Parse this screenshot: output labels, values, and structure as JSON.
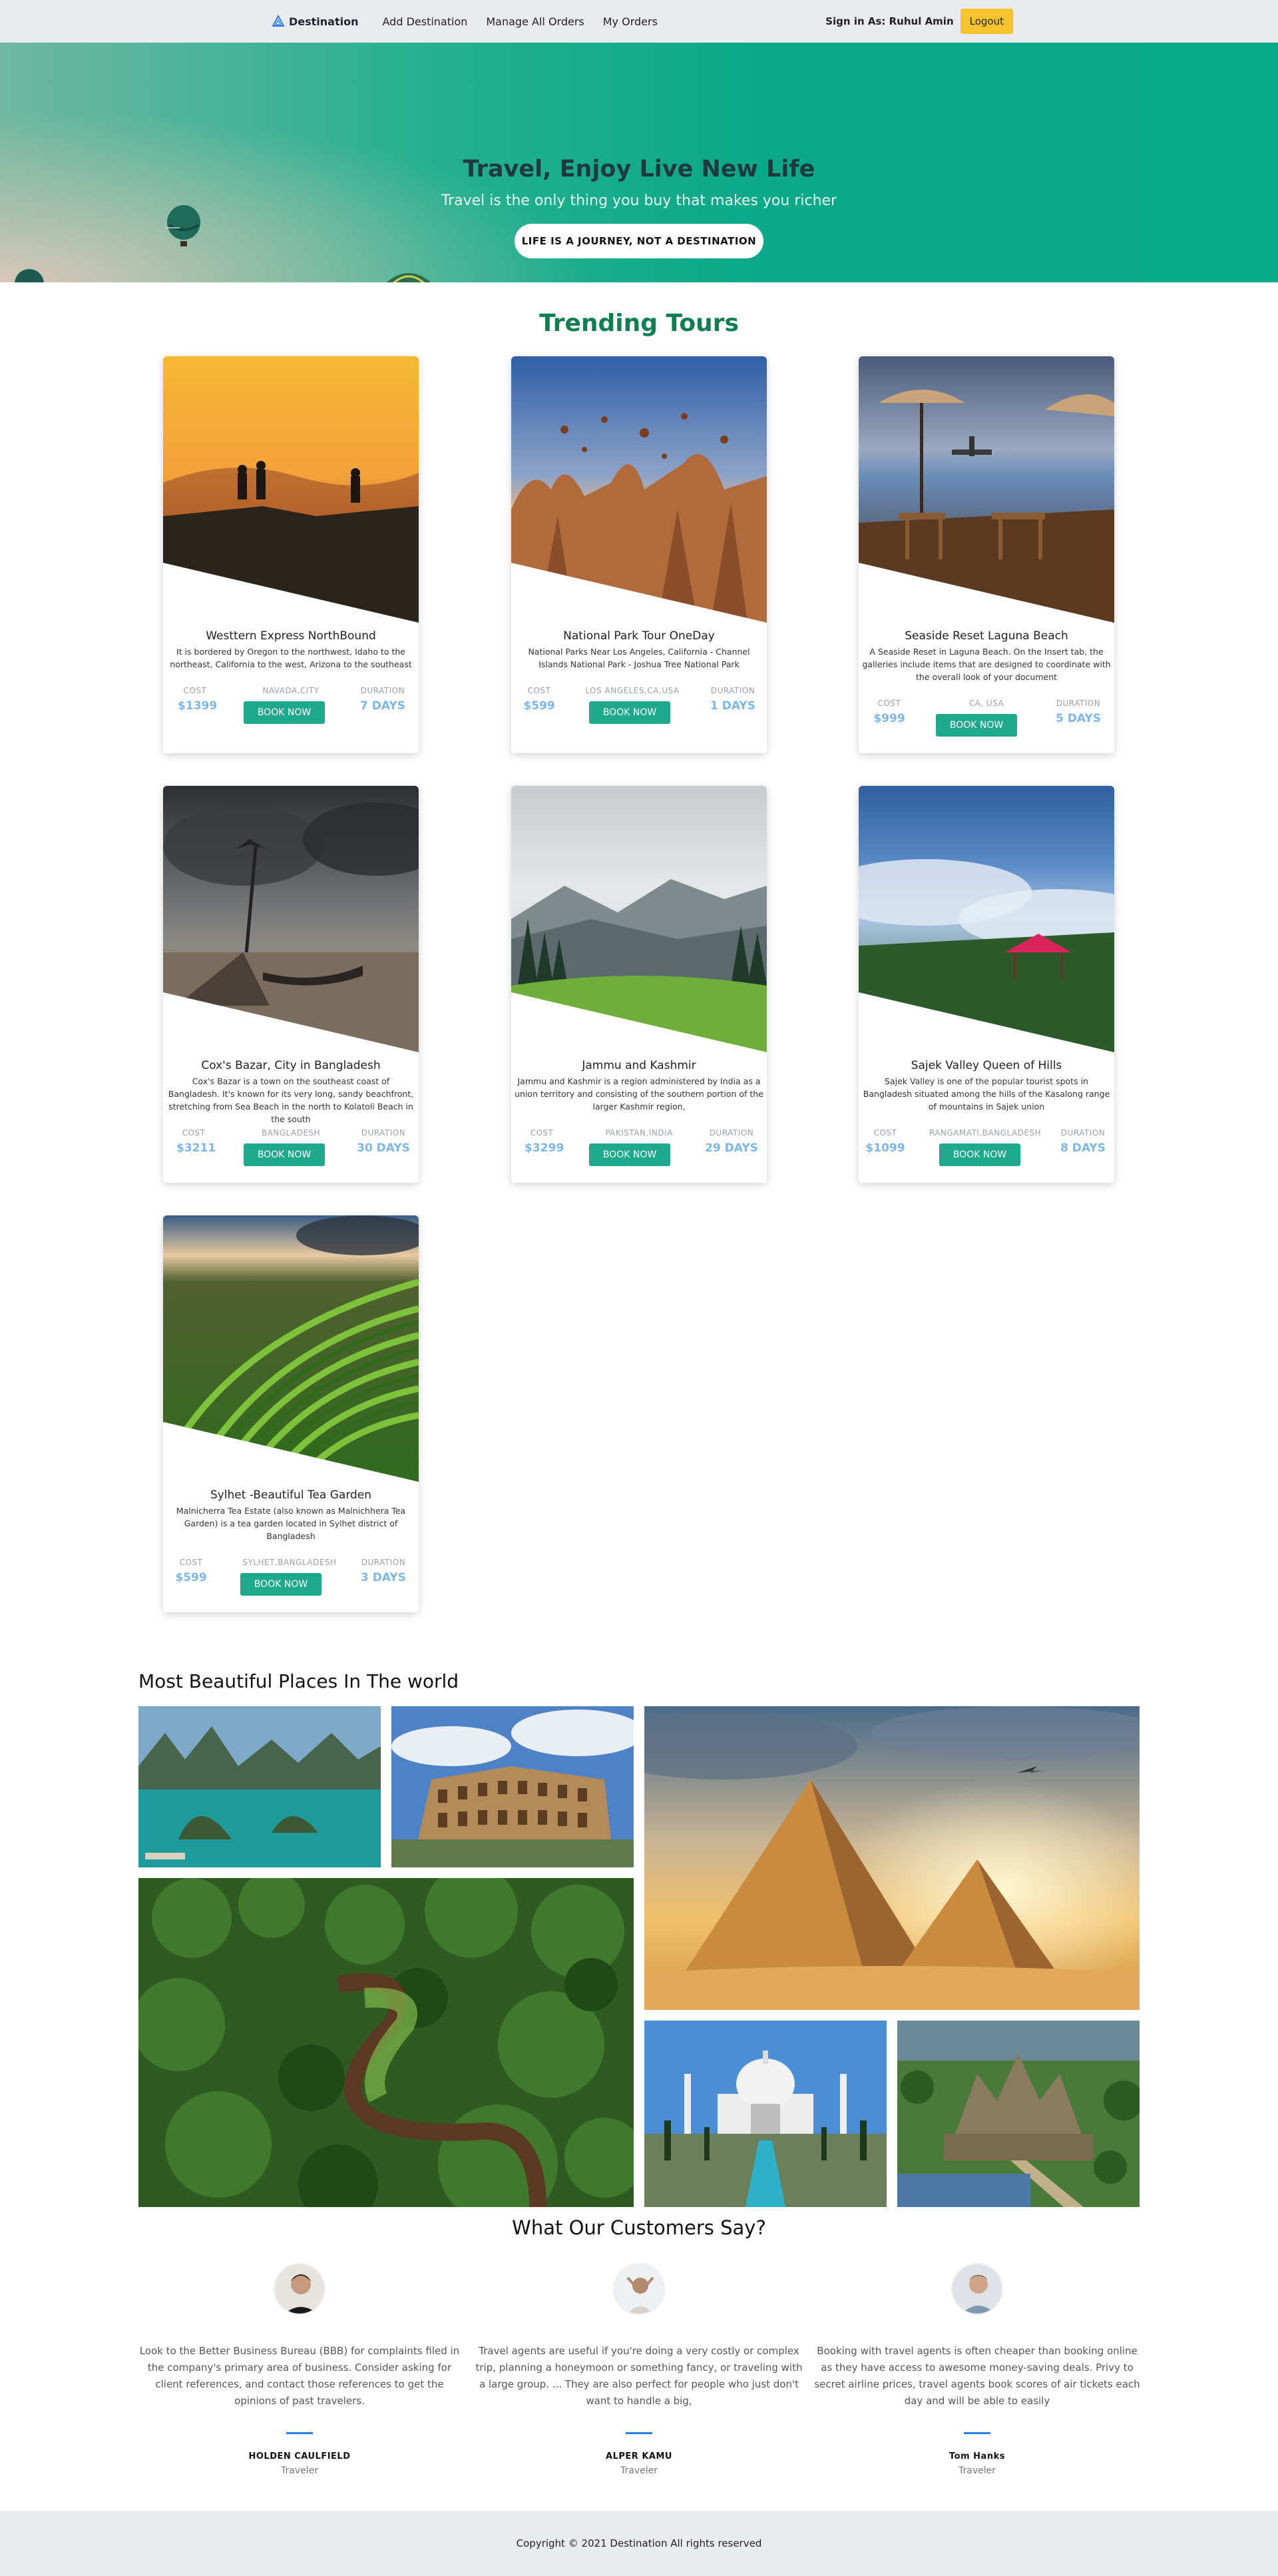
{
  "nav": {
    "brand": "Destination",
    "links": [
      "Add Destination",
      "Manage All Orders",
      "My Orders"
    ],
    "signin": "Sign in As: Ruhul Amin",
    "logout": "Logout"
  },
  "hero": {
    "title": "Travel, Enjoy Live New Life",
    "subtitle": "Travel is the only thing you buy that makes you richer",
    "button": "LIFE IS A JOURNEY, NOT A DESTINATION"
  },
  "trending": {
    "title": "Trending Tours",
    "labels": {
      "cost": "COST",
      "duration": "DURATION",
      "book": "BOOK NOW"
    },
    "tours": [
      {
        "title": "Westtern Express NorthBound",
        "desc": "It is bordered by Oregon to the northwest, Idaho to the northeast, California to the west, Arizona to the southeast",
        "cost": "$1399",
        "location": "NAVADA,CITY",
        "duration": "7 DAYS"
      },
      {
        "title": "National Park Tour OneDay",
        "desc": "National Parks Near Los Angeles, California - Channel Islands National Park - Joshua Tree National Park",
        "cost": "$599",
        "location": "LOS ANGELES,CA,USA",
        "duration": "1 DAYS"
      },
      {
        "title": "Seaside Reset Laguna Beach",
        "desc": "A Seaside Reset in Laguna Beach. On the Insert tab, the galleries include items that are designed to coordinate with the overall look of your document",
        "cost": "$999",
        "location": "CA, USA",
        "duration": "5 DAYS"
      },
      {
        "title": "Cox's Bazar, City in Bangladesh",
        "desc": "Cox's Bazar is a town on the southeast coast of Bangladesh. It's known for its very long, sandy beachfront, stretching from Sea Beach in the north to Kolatoli Beach in the south",
        "cost": "$3211",
        "location": "BANGLADESH",
        "duration": "30 DAYS"
      },
      {
        "title": "Jammu and Kashmir",
        "desc": "Jammu and Kashmir is a region administered by India as a union territory and consisting of the southern portion of the larger Kashmir region,",
        "cost": "$3299",
        "location": "PAKISTAN,INDIA",
        "duration": "29 DAYS"
      },
      {
        "title": "Sajek Valley Queen of Hills",
        "desc": "Sajek Valley is one of the popular tourist spots in Bangladesh situated among the hills of the Kasalong range of mountains in Sajek union",
        "cost": "$1099",
        "location": "RANGAMATI,BANGLADESH",
        "duration": "8 DAYS"
      },
      {
        "title": "Sylhet -Beautiful Tea Garden",
        "desc": "Malnicherra Tea Estate (also known as Malnichhera Tea Garden) is a tea garden located in Sylhet district of Bangladesh",
        "cost": "$599",
        "location": "SYLHET,BANGLADESH",
        "duration": "3 DAYS"
      }
    ]
  },
  "gallery": {
    "title": "Most Beautiful Places In The world"
  },
  "testimonials": {
    "title": "What Our Customers Say?",
    "items": [
      {
        "text": "Look to the Better Business Bureau (BBB) for complaints filed in the company's primary area of business. Consider asking for client references, and contact those references to get the opinions of past travelers.",
        "name": "HOLDEN CAULFIELD",
        "role": "Traveler"
      },
      {
        "text": "Travel agents are useful if you're doing a very costly or complex trip, planning a honeymoon or something fancy, or traveling with a large group. ... They are also perfect for people who just don't want to handle a big,",
        "name": "ALPER KAMU",
        "role": "Traveler"
      },
      {
        "text": "Booking with travel agents is often cheaper than booking online as they have access to awesome money-saving deals. Privy to secret airline prices, travel agents book scores of air tickets each day and will be able to easily",
        "name": "Tom Hanks",
        "role": "Traveler"
      }
    ]
  },
  "footer": {
    "text": "Copyright © 2021 Destination All rights reserved"
  },
  "colors": {
    "accent": "#1fa98c",
    "title_green": "#0f7f4f",
    "logout": "#f7c52b",
    "meta_value": "#7db6e8"
  }
}
